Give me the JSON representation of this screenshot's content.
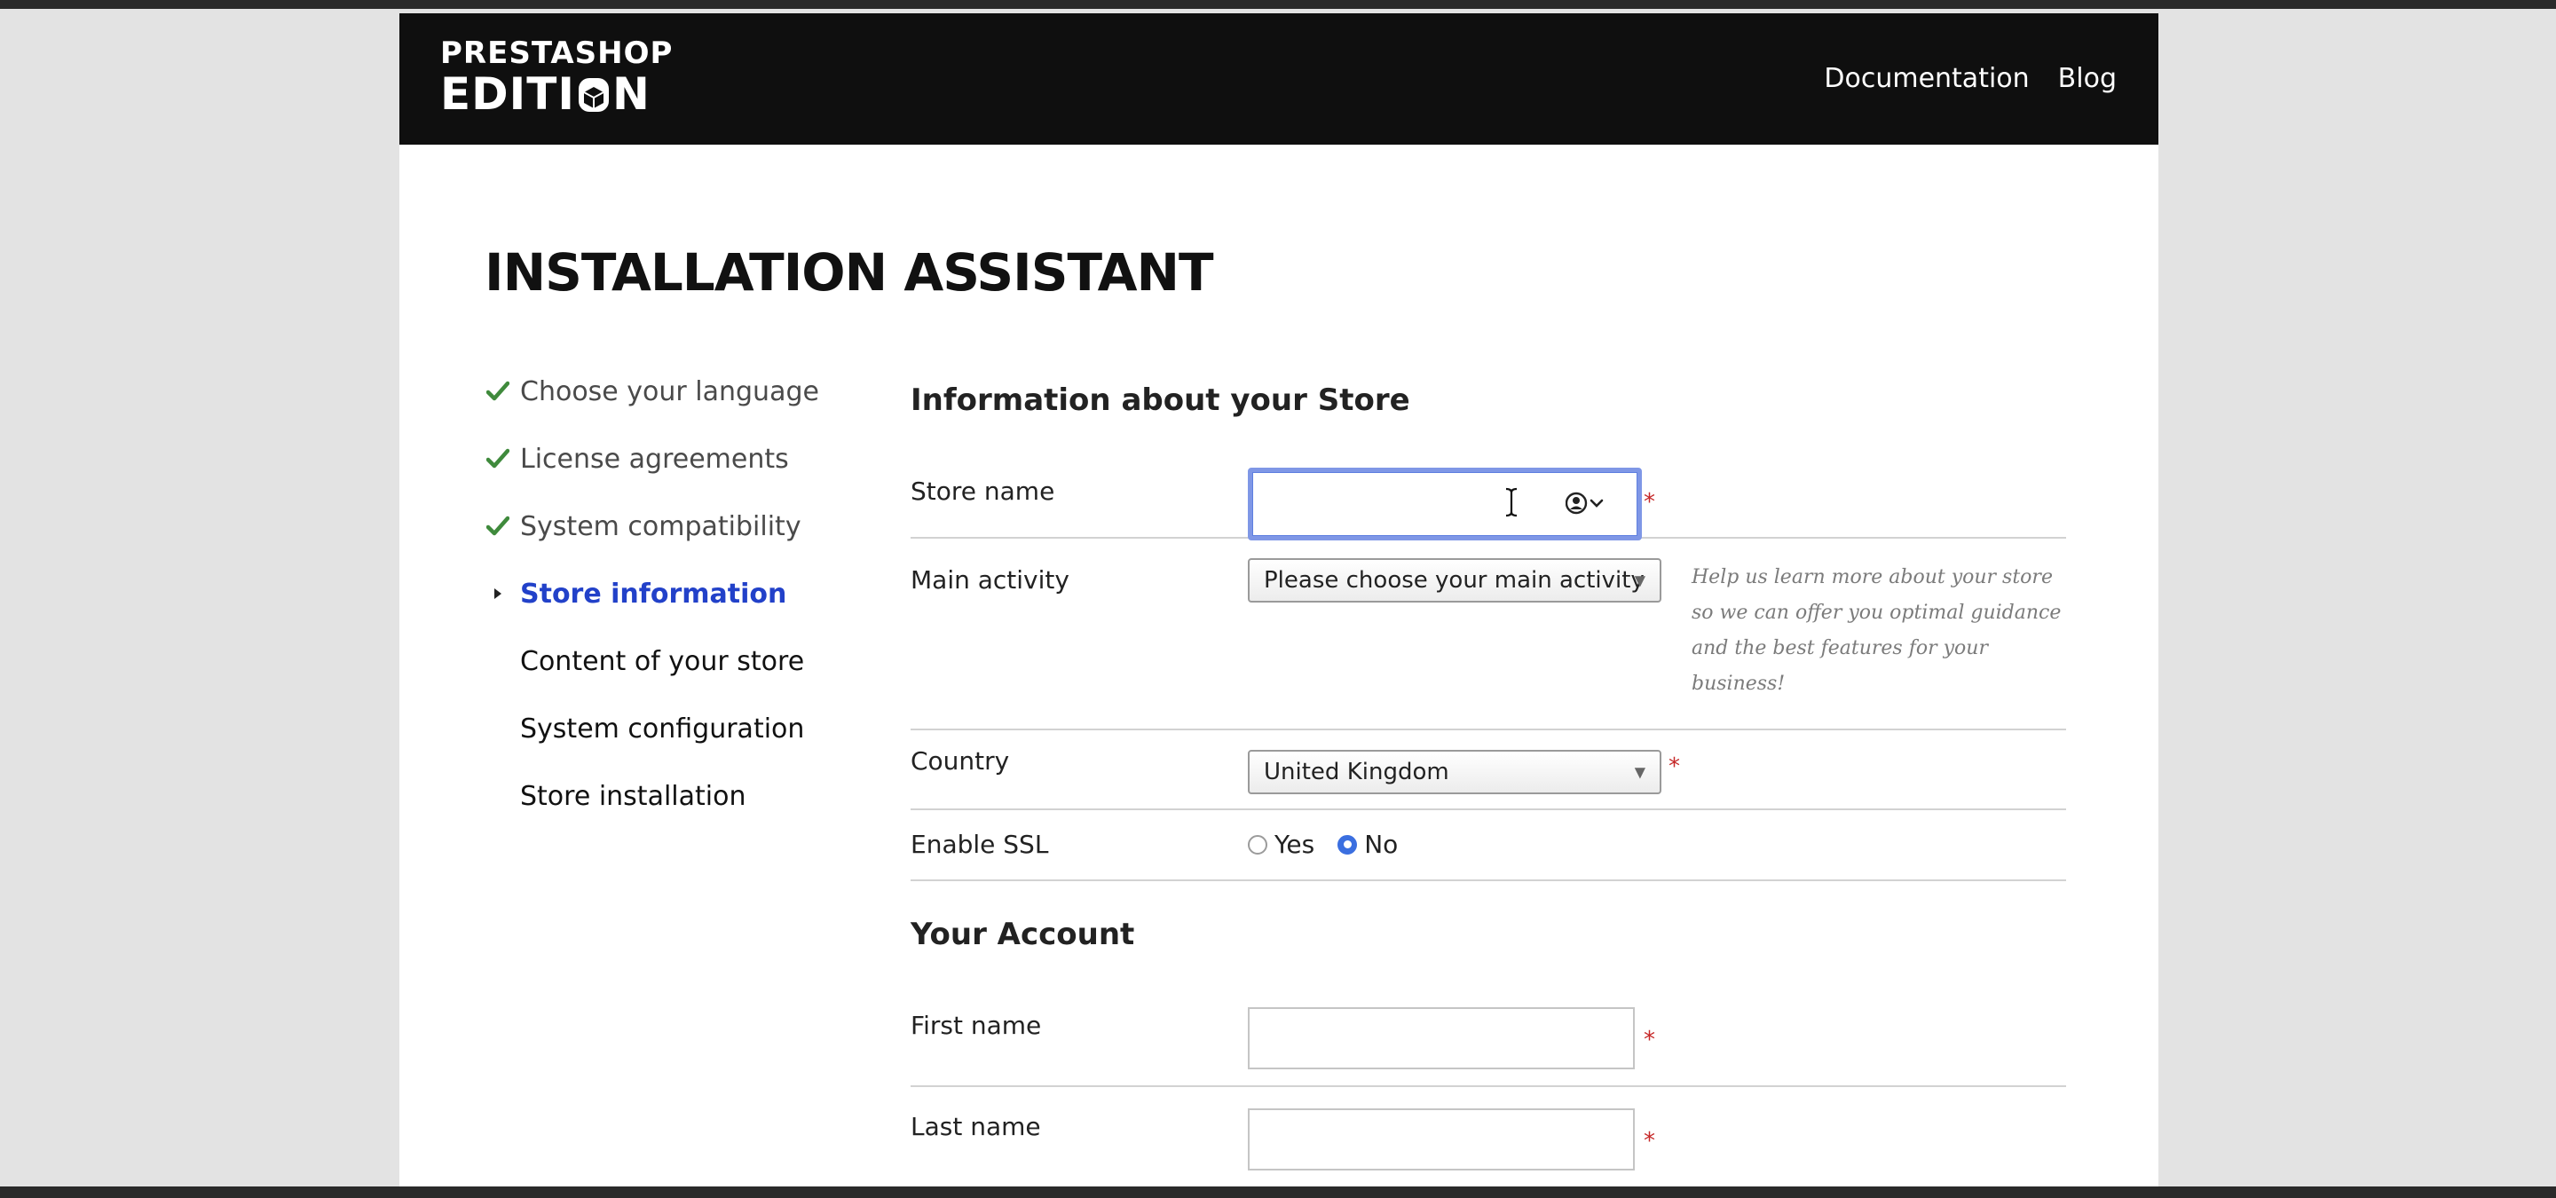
{
  "header": {
    "logo_top": "PRESTASHOP",
    "logo_bottom_left": "EDITI",
    "logo_bottom_right": "N",
    "nav": [
      "Documentation",
      "Blog"
    ]
  },
  "page_title": "INSTALLATION ASSISTANT",
  "steps": [
    {
      "label": "Choose your language",
      "status": "done"
    },
    {
      "label": "License agreements",
      "status": "done"
    },
    {
      "label": "System compatibility",
      "status": "done"
    },
    {
      "label": "Store information",
      "status": "current"
    },
    {
      "label": "Content of your store",
      "status": "pending"
    },
    {
      "label": "System configuration",
      "status": "pending"
    },
    {
      "label": "Store installation",
      "status": "pending"
    }
  ],
  "store_section": {
    "title": "Information about your Store",
    "store_name": {
      "label": "Store name",
      "value": "",
      "required": "*"
    },
    "main_activity": {
      "label": "Main activity",
      "selected": "Please choose your main activity",
      "help": "Help us learn more about your store so we can offer you optimal guidance and the best features for your business!"
    },
    "country": {
      "label": "Country",
      "selected": "United Kingdom",
      "required": "*"
    },
    "ssl": {
      "label": "Enable SSL",
      "options": [
        "Yes",
        "No"
      ],
      "selected": "No"
    }
  },
  "account_section": {
    "title": "Your Account",
    "first_name": {
      "label": "First name",
      "value": "",
      "required": "*"
    },
    "last_name": {
      "label": "Last name",
      "value": "",
      "required": "*"
    }
  },
  "colors": {
    "header_bg": "#0f0f0f",
    "current_step": "#2241c9",
    "check": "#3f8a3c",
    "required": "#c62828",
    "focus_ring": "#7f97e6"
  },
  "icons": {
    "check": "check-icon",
    "current": "triangle-right-icon",
    "autofill": "contact-autofill-icon",
    "text_cursor": "text-cursor-icon"
  }
}
